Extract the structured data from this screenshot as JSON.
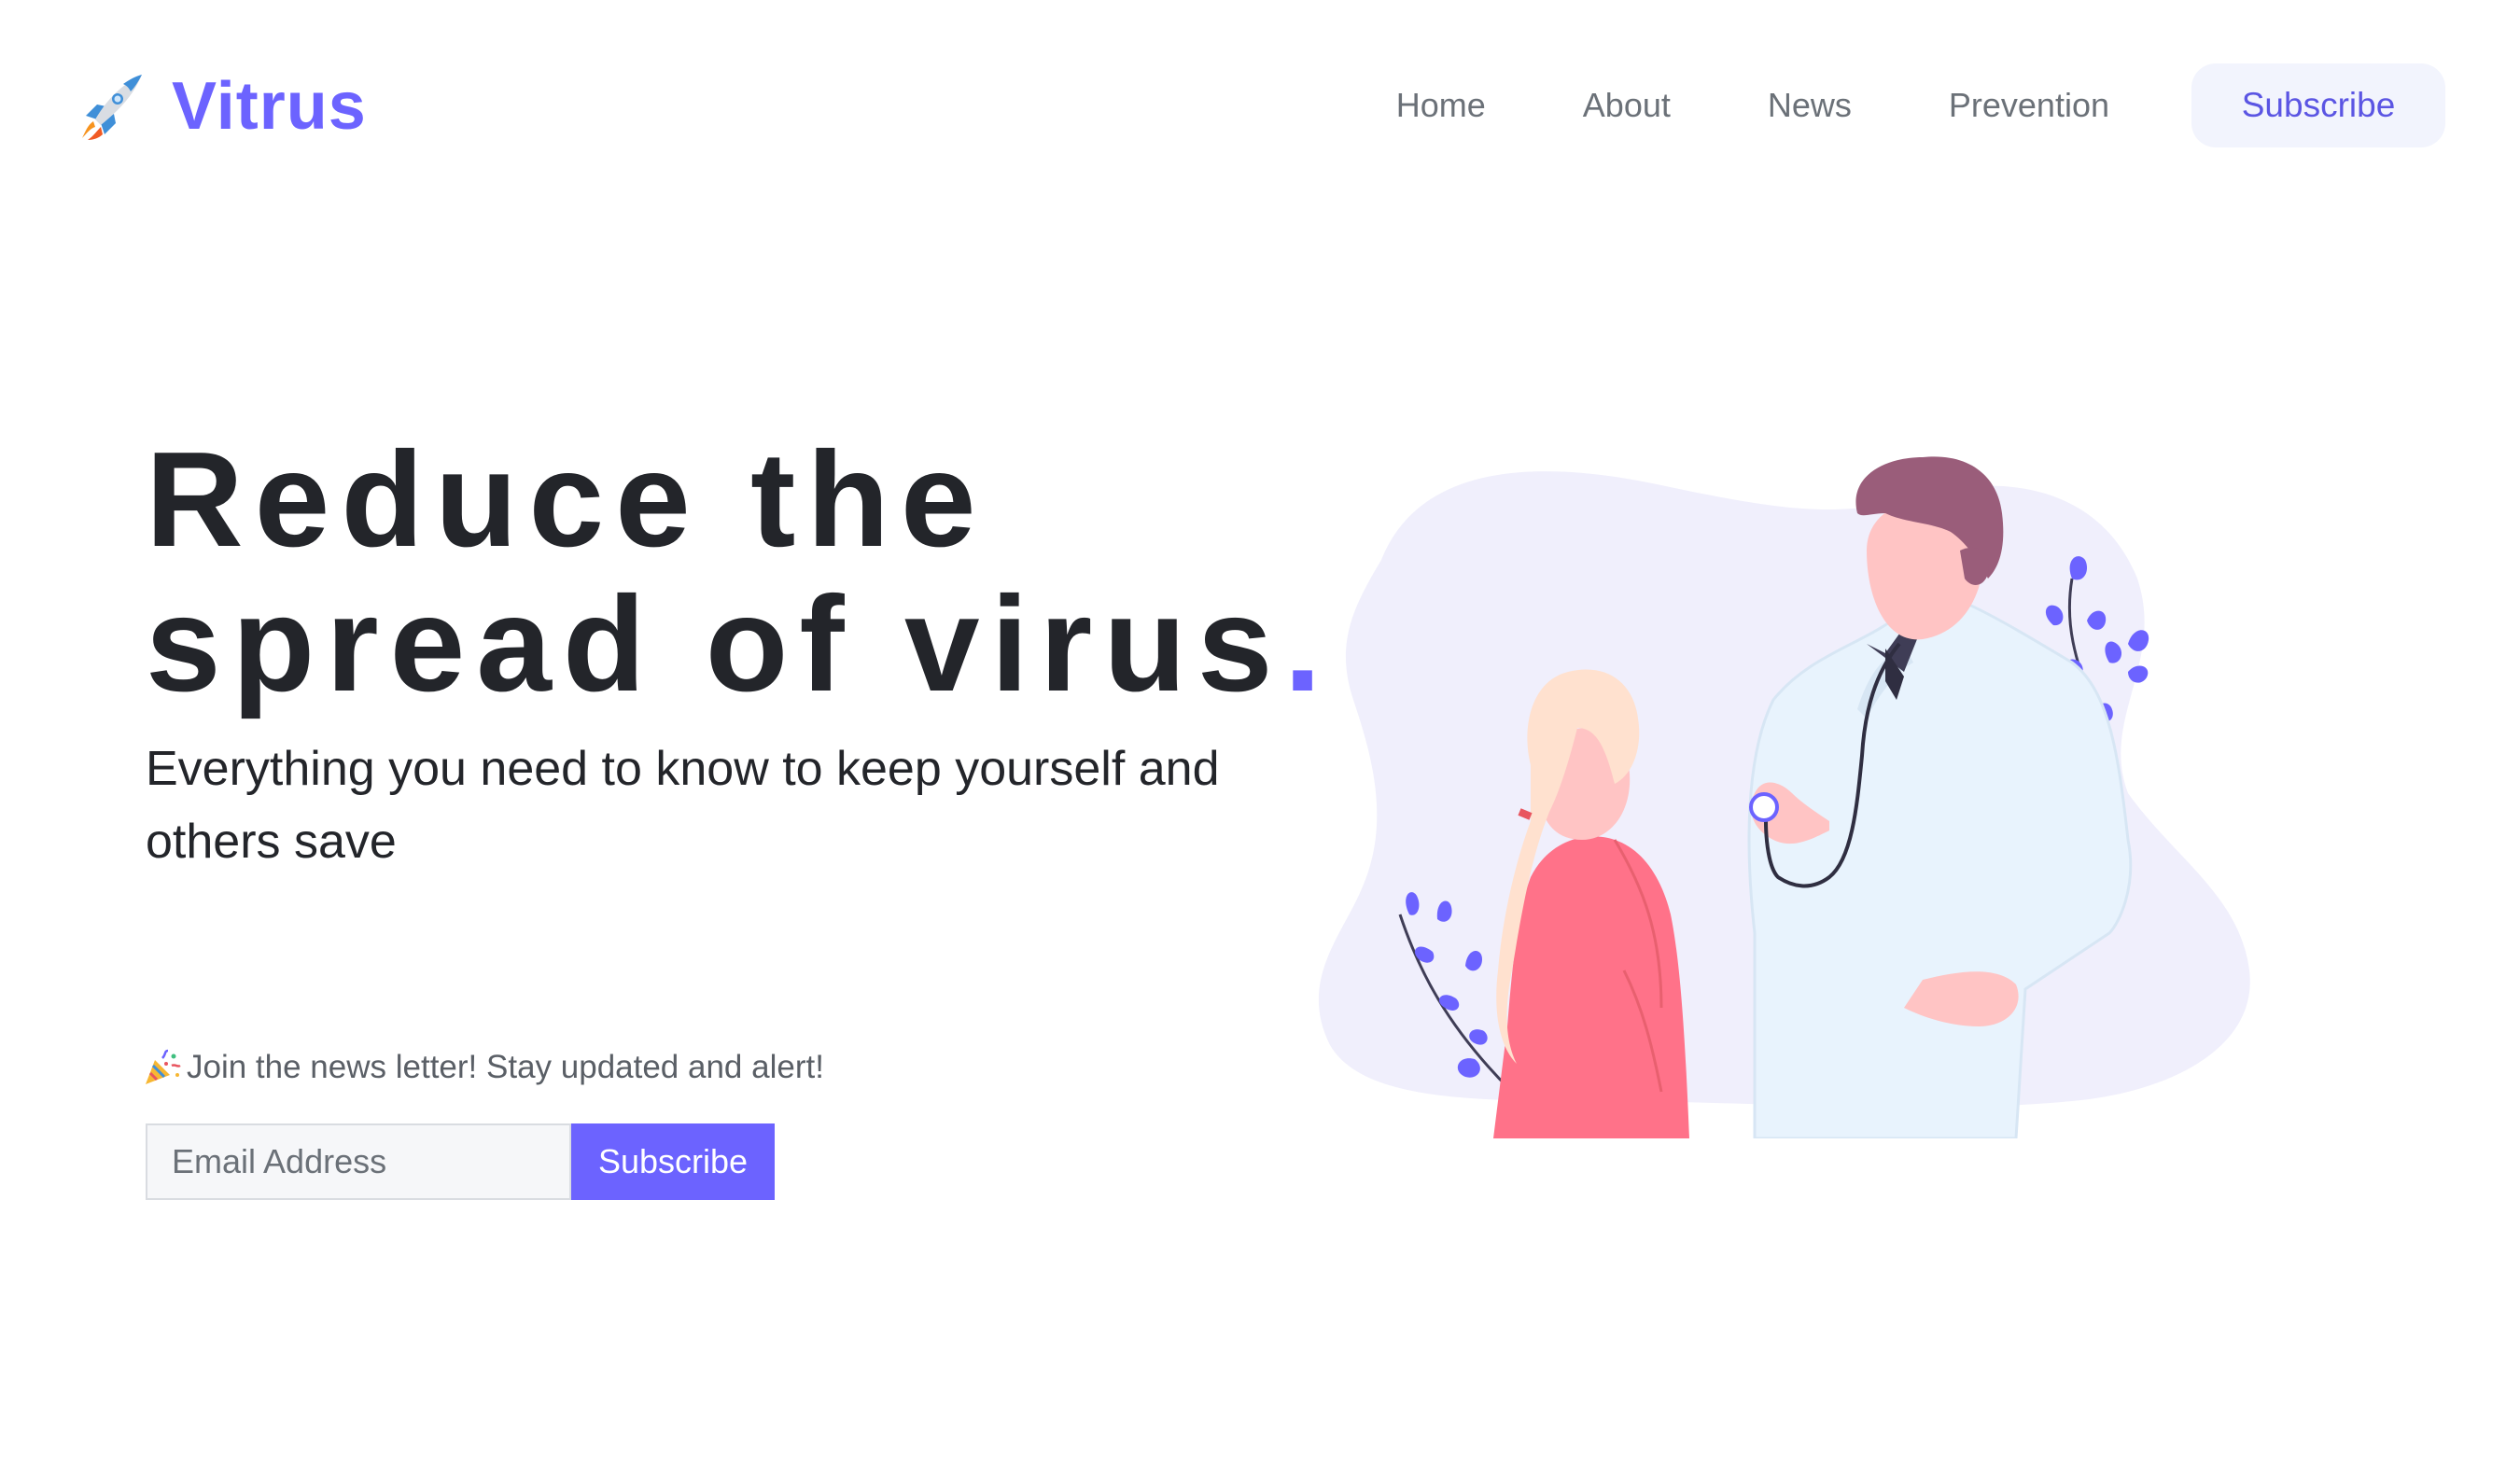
{
  "header": {
    "brand": "Vitrus",
    "brand_icon": "rocket-icon",
    "nav": {
      "home": "Home",
      "about": "About",
      "news": "News",
      "prevention": "Prevention",
      "subscribe": "Subscribe"
    }
  },
  "hero": {
    "title_line1": "Reduce the",
    "title_line2": "spread of virus",
    "title_dot": ".",
    "subtitle": "Everything you need to know to keep yourself and others save",
    "newsletter_label": "Join the news letter! Stay updated and alert!",
    "newsletter_icon": "party-popper-icon",
    "email_placeholder": "Email Address",
    "subscribe_button": "Subscribe"
  },
  "illustration": "doctor-checking-patient-illustration",
  "colors": {
    "accent": "#6c63ff",
    "text_dark": "#23252a",
    "nav_text": "#6b7178",
    "subscribe_bg": "#f2f4fd",
    "blob": "#f0effc",
    "leaf": "#6c63ff",
    "shirt_patient": "#ff7289",
    "coat": "#e8f3fd",
    "hair_doctor": "#9a5d7a",
    "skin": "#ffc4c4"
  }
}
